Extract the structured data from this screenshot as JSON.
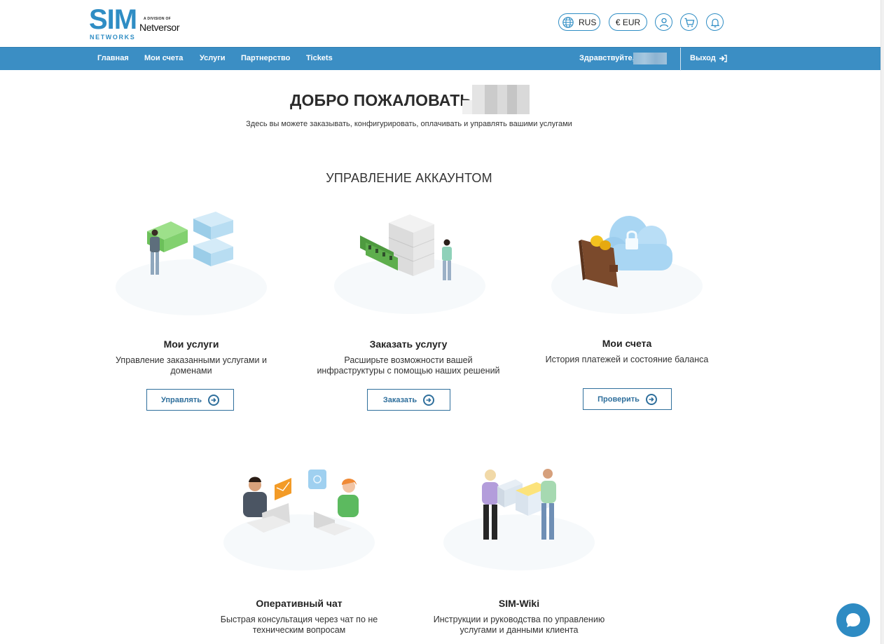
{
  "brand": {
    "logo_main": "SIM",
    "logo_sub": "NETWORKS",
    "division_label": "A DIVISION OF",
    "division_name": "Netversor"
  },
  "header": {
    "language": "RUS",
    "currency": "€ EUR",
    "icons": [
      "globe-icon",
      "user-icon",
      "cart-icon",
      "bell-icon"
    ]
  },
  "nav": {
    "items": [
      {
        "label": "Главная"
      },
      {
        "label": "Мои счета"
      },
      {
        "label": "Услуги"
      },
      {
        "label": "Партнерство"
      },
      {
        "label": "Tickets"
      }
    ],
    "greeting": "Здравствуйте,",
    "logout": "Выход"
  },
  "main": {
    "welcome": "ДОБРО ПОЖАЛОВАТЬ,",
    "subtitle": "Здесь вы можете заказывать, конфигурировать, оплачивать и управлять вашими услугами",
    "section_title": "УПРАВЛЕНИЕ АККАУНТОМ"
  },
  "cards": [
    {
      "title": "Мои услуги",
      "desc_1": "Управление заказанными услугами и",
      "desc_2": "доменами",
      "button": "Управлять"
    },
    {
      "title": "Заказать услугу",
      "desc_1": "Расширьте возможности вашей",
      "desc_2": "инфраструктуры с помощью наших решений",
      "button": "Заказать"
    },
    {
      "title": "Мои счета",
      "desc_1": "История платежей и состояние баланса",
      "desc_2": "",
      "button": "Проверить"
    },
    {
      "title": "Оперативный чат",
      "desc_1": "Быстрая консультация через чат по не",
      "desc_2": "техническим вопросам",
      "button": ""
    },
    {
      "title": "SIM-Wiki",
      "desc_1": "Инструкции и руководства по управлению",
      "desc_2": "услугами и данными клиента",
      "button": ""
    }
  ],
  "colors": {
    "brand_blue": "#2f8dc4",
    "nav_bg": "#3b8ec4",
    "button_border": "#2f6f9c"
  }
}
